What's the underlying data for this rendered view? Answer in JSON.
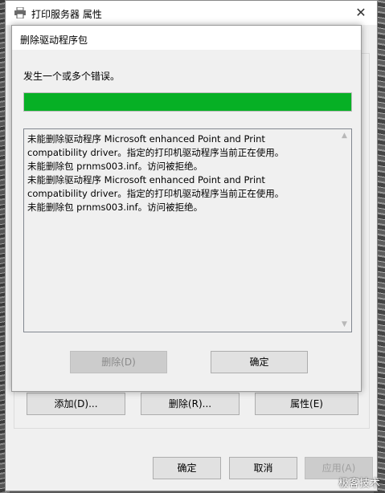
{
  "outer_window": {
    "title": "打印服务器 属性",
    "close_glyph": "✕",
    "middle_buttons": {
      "add": "添加(D)...",
      "remove": "删除(R)...",
      "properties": "属性(E)"
    },
    "footer_buttons": {
      "ok": "确定",
      "cancel": "取消",
      "apply": "应用(A)"
    }
  },
  "dialog": {
    "title": "删除驱动程序包",
    "message": "发生一个或多个错误。",
    "progress_percent": 100,
    "progress_color": "#06b025",
    "log_lines": [
      "未能删除驱动程序 Microsoft enhanced Point and Print",
      "compatibility driver。指定的打印机驱动程序当前正在使用。",
      "未能删除包 prnms003.inf。访问被拒绝。",
      "未能删除驱动程序 Microsoft enhanced Point and Print",
      "compatibility driver。指定的打印机驱动程序当前正在使用。",
      "未能删除包 prnms003.inf。访问被拒绝。"
    ],
    "scroll_up_glyph": "▲",
    "scroll_down_glyph": "▼",
    "delete_button": "删除(D)",
    "ok_button": "确定"
  },
  "watermark": "极客技术"
}
